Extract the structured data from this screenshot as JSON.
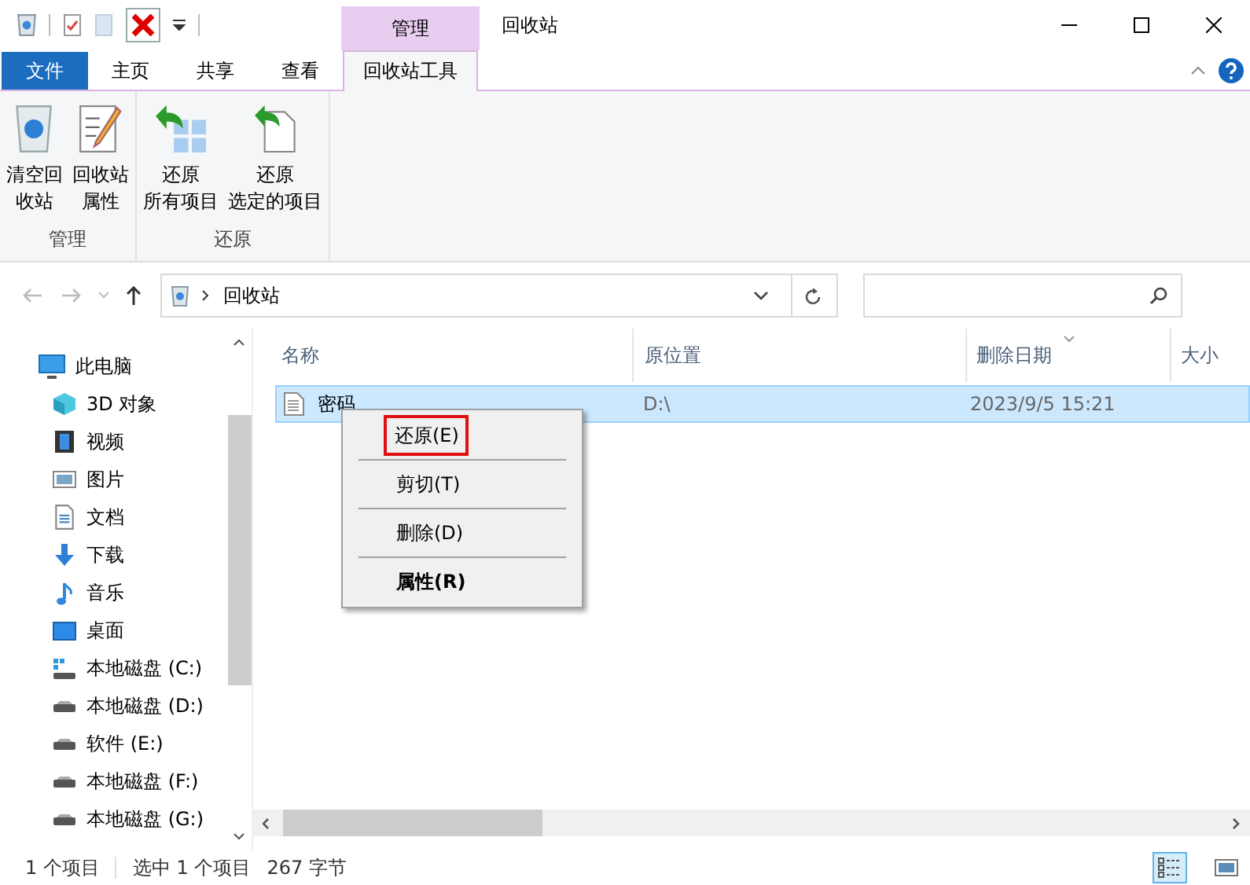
{
  "title_bar": {
    "context_tab": "管理",
    "title": "回收站"
  },
  "ribbon_tabs": [
    {
      "label": "文件",
      "kind": "file",
      "selected": false
    },
    {
      "label": "主页",
      "kind": "tab",
      "selected": false
    },
    {
      "label": "共享",
      "kind": "tab",
      "selected": false
    },
    {
      "label": "查看",
      "kind": "tab",
      "selected": false
    },
    {
      "label": "回收站工具",
      "kind": "context",
      "selected": true
    }
  ],
  "ribbon_groups": [
    {
      "label": "管理",
      "buttons": [
        {
          "lines": [
            "清空回",
            "收站"
          ],
          "kind": "bin"
        },
        {
          "lines": [
            "回收站",
            "属性"
          ],
          "kind": "props"
        }
      ]
    },
    {
      "label": "还原",
      "buttons": [
        {
          "lines": [
            "还原",
            "所有项目"
          ],
          "kind": "restore-all"
        },
        {
          "lines": [
            "还原",
            "选定的项目"
          ],
          "kind": "restore-one"
        }
      ]
    }
  ],
  "address": {
    "path": "回收站"
  },
  "sidebar": [
    {
      "label": "此电脑",
      "kind": "pc",
      "children": [
        {
          "label": "3D 对象",
          "kind": "cube"
        },
        {
          "label": "视频",
          "kind": "film"
        },
        {
          "label": "图片",
          "kind": "image"
        },
        {
          "label": "文档",
          "kind": "doc"
        },
        {
          "label": "下载",
          "kind": "download"
        },
        {
          "label": "音乐",
          "kind": "music"
        },
        {
          "label": "桌面",
          "kind": "desktop"
        },
        {
          "label": "本地磁盘 (C:)",
          "kind": "drive-win"
        },
        {
          "label": "本地磁盘 (D:)",
          "kind": "drive"
        },
        {
          "label": "软件 (E:)",
          "kind": "drive"
        },
        {
          "label": "本地磁盘 (F:)",
          "kind": "drive"
        },
        {
          "label": "本地磁盘 (G:)",
          "kind": "drive"
        }
      ]
    }
  ],
  "columns": [
    {
      "label": "名称",
      "sorted": false
    },
    {
      "label": "原位置",
      "sorted": false
    },
    {
      "label": "删除日期",
      "sorted": true
    },
    {
      "label": "大小",
      "sorted": false
    }
  ],
  "rows": [
    {
      "cells": [
        "密码",
        "D:\\",
        "2023/9/5 15:21"
      ],
      "selected": true
    }
  ],
  "context_menu": [
    {
      "label": "还原(E)",
      "focused": true,
      "bold": false
    },
    {
      "label": "剪切(T)",
      "focused": false,
      "bold": false
    },
    {
      "label": "删除(D)",
      "focused": false,
      "bold": false
    },
    {
      "label": "属性(R)",
      "focused": false,
      "bold": true
    }
  ],
  "status_bar": [
    "1 个项目",
    "选中 1 个项目",
    "267 字节"
  ],
  "view_buttons": [
    {
      "kind": "details",
      "selected": true
    },
    {
      "kind": "large-icons",
      "selected": false
    }
  ]
}
